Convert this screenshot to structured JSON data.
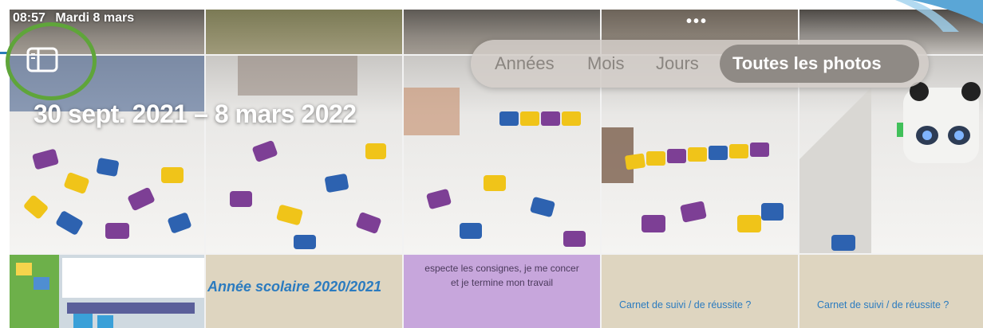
{
  "status_bar": {
    "time": "08:57",
    "date": "Mardi 8 mars"
  },
  "more_icon": "ellipsis-icon",
  "sidebar_icon": "sidebar-icon",
  "date_range": "30 sept. 2021 – 8 mars 2022",
  "segmented_control": {
    "options": [
      "Années",
      "Mois",
      "Jours",
      "Toutes les photos"
    ],
    "selected": "Toutes les photos"
  },
  "tiles_bottom": {
    "doc_title": "Année scolaire 2020/2021",
    "consignes_line1": "especte les consignes, je me concer",
    "consignes_line2": "et je termine mon travail",
    "carnet_a": "Carnet de suivi / de réussite ?",
    "carnet_b": "Carnet de suivi / de réussite ?"
  },
  "colors": {
    "annotation_circle": "#5fa53a",
    "segment_active": "#8f8a85",
    "doc_blue": "#2b7bbf",
    "lavender": "#c7a6dc"
  }
}
